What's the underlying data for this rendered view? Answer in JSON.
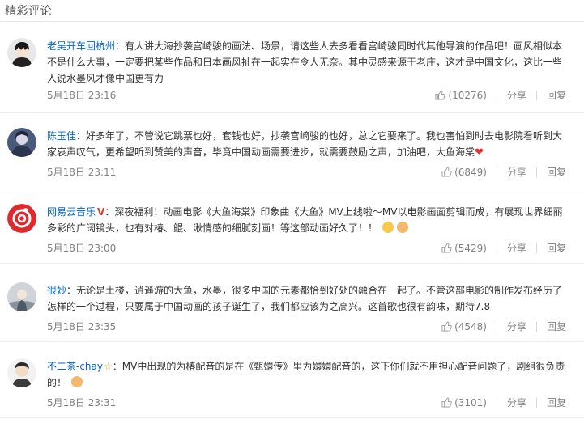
{
  "section": {
    "title": "精彩评论"
  },
  "actions": {
    "share": "分享",
    "reply": "回复"
  },
  "comments": [
    {
      "username": "老吴开车回杭州",
      "text": "有人讲大海抄袭宫崎骏的画法、场景，请这些人去多看看宫崎骏同时代其他导演的作品吧！画风相似本不是什么大事，一定要把某些作品和日本画风扯在一起实在令人无奈。其中灵感来源于老庄，这才是中国文化，这比一些人说水墨风才像中国更有力",
      "timestamp": "5月18日 23:16",
      "likes": "(10276)"
    },
    {
      "username": "陈玉佳",
      "text": "好多年了，不管说它跳票也好，套钱也好，抄袭宫崎骏的也好，总之它要来了。我也害怕到时去电影院看听到大家哀声叹气，更希望听到赞美的声音，毕竟中国动画需要进步，就需要鼓励之声，加油吧，大鱼海棠",
      "timestamp": "5月18日 23:11",
      "likes": "(6849)"
    },
    {
      "username": "网易云音乐",
      "badge": "V",
      "text": "深夜福利！动画电影《大鱼海棠》印象曲《大鱼》MV上线啦～MV以电影画面剪辑而成，有展现世界细丽多彩的广阔镜头，也有对椿、鲲、湫情感的细腻刻画！等这部动画好久了！！",
      "timestamp": "5月18日 23:00",
      "likes": "(5429)"
    },
    {
      "username": "很妙",
      "text": "无论是土楼，逍遥游的大鱼，水墨，很多中国的元素都恰到好处的融合在一起了。不管这部电影的制作发布经历了怎样的一个过程，只要属于中国动画的孩子诞生了，我们都应该为之高兴。这首歌也很有韵味，期待7.8",
      "timestamp": "5月18日 23:35",
      "likes": "(4548)"
    },
    {
      "username": "不二茶-chay",
      "text": "MV中出现的为椿配音的是在《甄嬛传》里为嬛嬛配音的，这下你们就不用担心配音问题了，剧组很负责的！",
      "timestamp": "5月18日 23:31",
      "likes": "(3101)"
    }
  ]
}
